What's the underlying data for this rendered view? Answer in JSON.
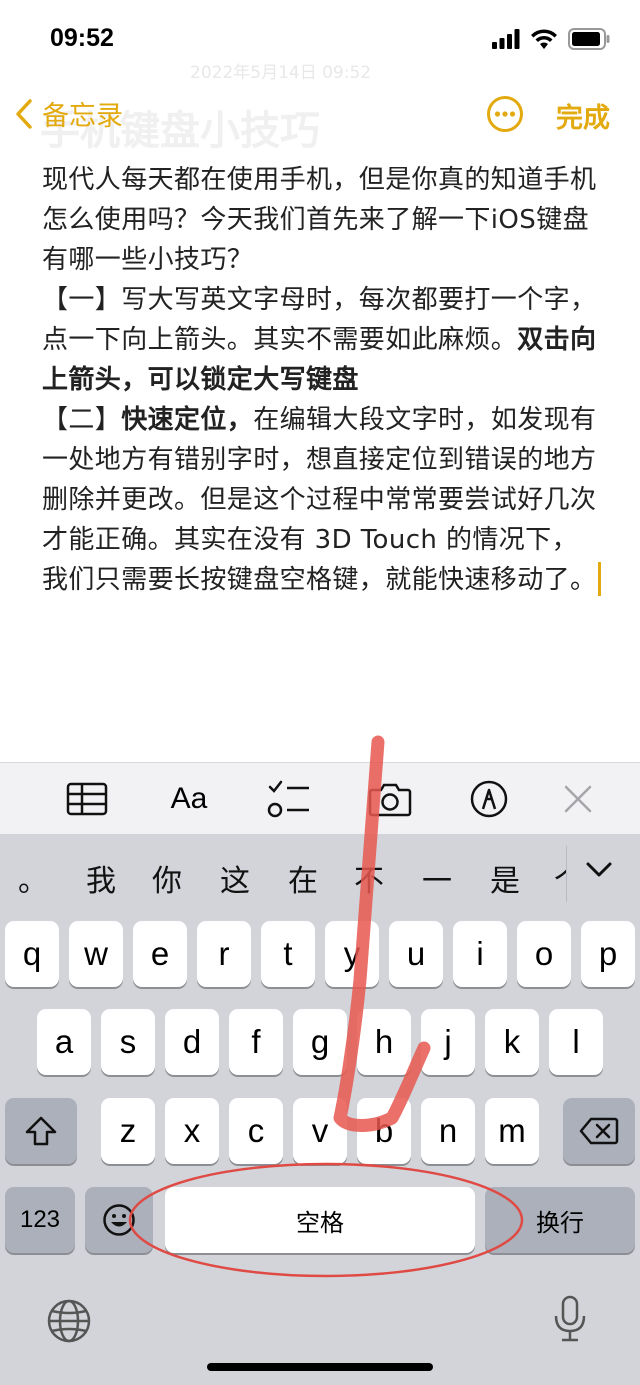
{
  "status": {
    "time": "09:52"
  },
  "nav": {
    "back_label": "备忘录",
    "done_label": "完成",
    "ghost_date": "2022年5月14日 09:52",
    "ghost_title": "手机键盘小技巧"
  },
  "note": {
    "p1": "现代人每天都在使用手机，但是你真的知道手机怎么使用吗？今天我们首先来了解一下iOS键盘有哪一些小技巧？",
    "p2a": "【一】写大写英文字母时，每次都要打一个字，点一下向上箭头。其实不需要如此麻烦。",
    "p2b": "双击向上箭头，可以锁定大写键盘",
    "p3a": "【二】",
    "p3b": "快速定位，",
    "p3c": "在编辑大段文字时，如发现有一处地方有错别字时，想直接定位到错误的地方删除并更改。但是这个过程中常常要尝试好几次才能正确。其实在没有 3D Touch 的情况下，我们只需要长按键盘空格键，就能快速移动了。"
  },
  "toolbar": {
    "icons": [
      "table-icon",
      "text-format-icon",
      "checklist-icon",
      "camera-icon",
      "markup-icon",
      "close-icon"
    ],
    "format_label": "Aa"
  },
  "keyboard": {
    "candidates": [
      "。",
      "我",
      "你",
      "这",
      "在",
      "不",
      "一",
      "是",
      "个"
    ],
    "row1": [
      "q",
      "w",
      "e",
      "r",
      "t",
      "y",
      "u",
      "i",
      "o",
      "p"
    ],
    "row2": [
      "a",
      "s",
      "d",
      "f",
      "g",
      "h",
      "j",
      "k",
      "l"
    ],
    "row3": [
      "z",
      "x",
      "c",
      "v",
      "b",
      "n",
      "m"
    ],
    "numbers_label": "123",
    "space_label": "空格",
    "return_label": "换行"
  },
  "annotations": {
    "arrow_color": "#e8574f",
    "ellipse_color": "#e04a44"
  },
  "colors": {
    "accent": "#e3aa10",
    "keyboard_bg": "#d2d4da",
    "dark_key": "#abb0ba"
  }
}
